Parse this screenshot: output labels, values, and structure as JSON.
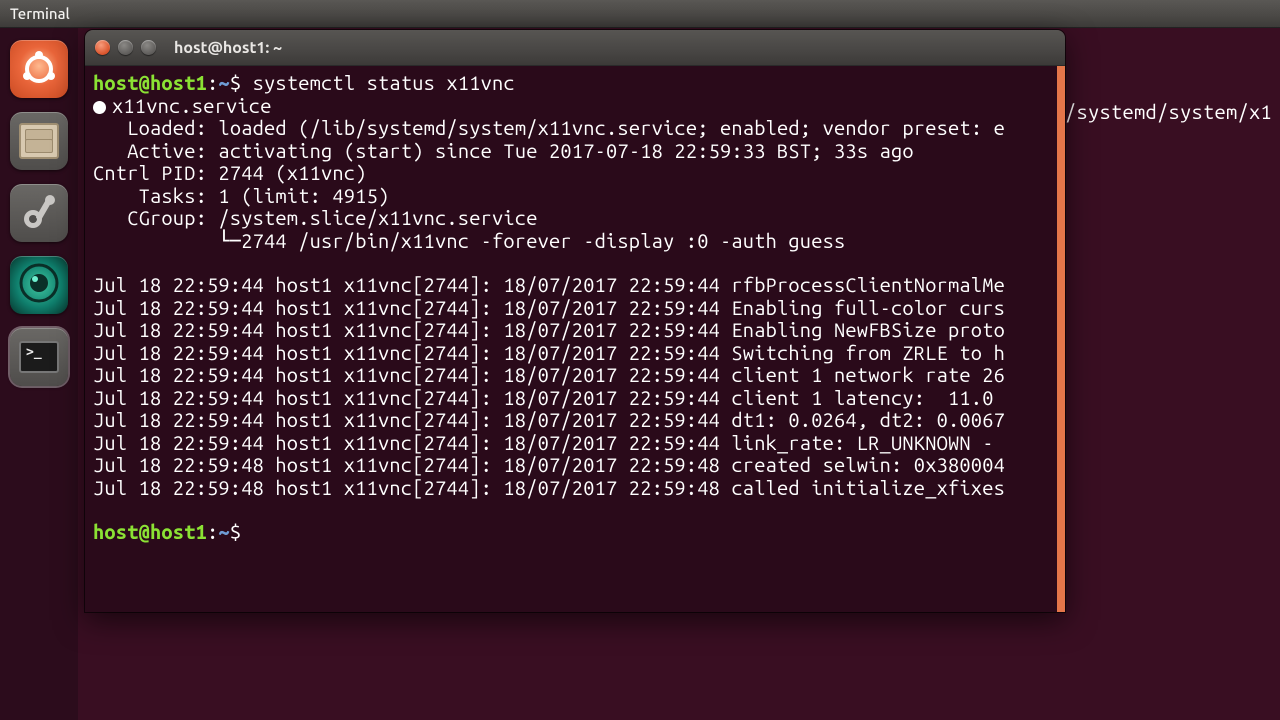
{
  "menubar": {
    "title": "Terminal"
  },
  "launcher": {
    "items": [
      {
        "name": "ubuntu-dash"
      },
      {
        "name": "files"
      },
      {
        "name": "settings"
      },
      {
        "name": "camera"
      },
      {
        "name": "terminal"
      }
    ]
  },
  "window": {
    "title": "host@host1: ~"
  },
  "bg_text": "/systemd/system/x1",
  "prompt": {
    "user_host": "host@host1",
    "separator": ":",
    "path": "~",
    "symbol": "$"
  },
  "command": "systemctl status x11vnc",
  "output": {
    "service": "x11vnc.service",
    "loaded_label": "Loaded:",
    "loaded_value": "loaded (/lib/systemd/system/x11vnc.service; enabled; vendor preset: e",
    "active_label": "Active:",
    "active_value": "activating (start) since Tue 2017-07-18 22:59:33 BST; 33s ago",
    "cntrl_pid": "Cntrl PID: 2744 (x11vnc)",
    "tasks": "    Tasks: 1 (limit: 4915)",
    "cgroup": "   CGroup: /system.slice/x11vnc.service",
    "cgroup_cmd": "           └─2744 /usr/bin/x11vnc -forever -display :0 -auth guess",
    "log_lines": [
      "Jul 18 22:59:44 host1 x11vnc[2744]: 18/07/2017 22:59:44 rfbProcessClientNormalMe",
      "Jul 18 22:59:44 host1 x11vnc[2744]: 18/07/2017 22:59:44 Enabling full-color curs",
      "Jul 18 22:59:44 host1 x11vnc[2744]: 18/07/2017 22:59:44 Enabling NewFBSize proto",
      "Jul 18 22:59:44 host1 x11vnc[2744]: 18/07/2017 22:59:44 Switching from ZRLE to h",
      "Jul 18 22:59:44 host1 x11vnc[2744]: 18/07/2017 22:59:44 client 1 network rate 26",
      "Jul 18 22:59:44 host1 x11vnc[2744]: 18/07/2017 22:59:44 client 1 latency:  11.0 ",
      "Jul 18 22:59:44 host1 x11vnc[2744]: 18/07/2017 22:59:44 dt1: 0.0264, dt2: 0.0067",
      "Jul 18 22:59:44 host1 x11vnc[2744]: 18/07/2017 22:59:44 link_rate: LR_UNKNOWN - ",
      "Jul 18 22:59:48 host1 x11vnc[2744]: 18/07/2017 22:59:48 created selwin: 0x380004",
      "Jul 18 22:59:48 host1 x11vnc[2744]: 18/07/2017 22:59:48 called initialize_xfixes"
    ]
  },
  "labels": {
    "loaded_indent": "   ",
    "active_indent": "   "
  }
}
